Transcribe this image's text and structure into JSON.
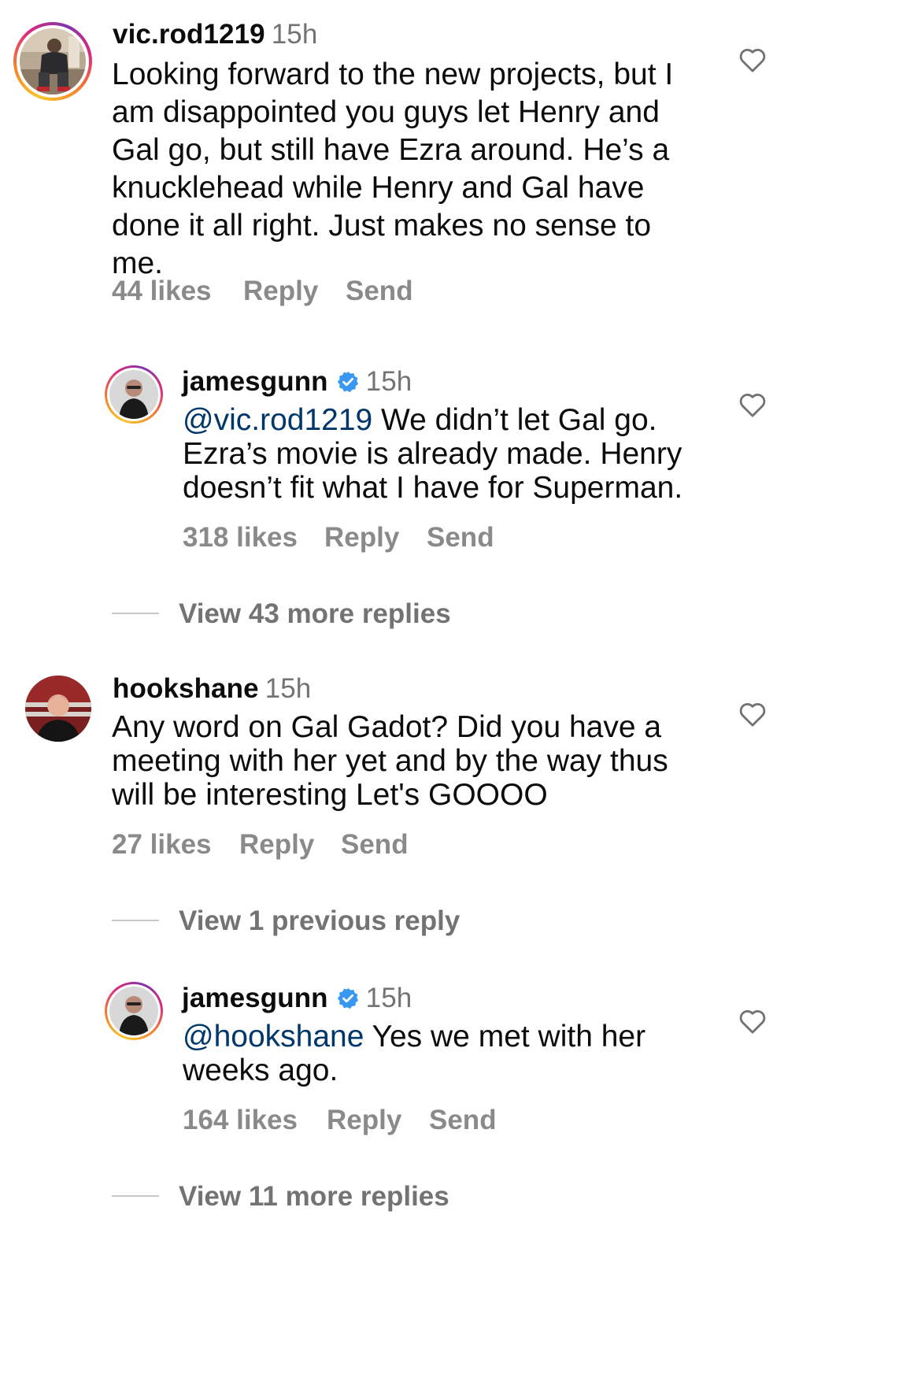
{
  "comments": [
    {
      "username": "vic.rod1219",
      "time": "15h",
      "lines": [
        "Looking forward to the new projects, but I",
        "am disappointed you guys let Henry and",
        "Gal go, but still have Ezra around. He’s a",
        "knucklehead while Henry and Gal have",
        "done it all right. Just makes no sense to",
        "me."
      ],
      "likes": "44 likes",
      "reply": "Reply",
      "send": "Send",
      "replies": [
        {
          "username": "jamesgunn",
          "verified": true,
          "time": "15h",
          "mention": "@vic.rod1219",
          "line1_rest": " We didn’t let Gal go.",
          "lines": [
            "Ezra’s movie is already made. Henry",
            "doesn’t fit what I have for Superman."
          ],
          "likes": "318 likes",
          "reply": "Reply",
          "send": "Send"
        }
      ],
      "view_more": "View 43 more replies"
    },
    {
      "username": "hookshane",
      "time": "15h",
      "lines": [
        "Any word on Gal Gadot? Did you have a",
        "meeting with her yet and by the way thus",
        "will be interesting Let's GOOOO"
      ],
      "likes": "27 likes",
      "reply": "Reply",
      "send": "Send",
      "view_previous": "View 1 previous reply",
      "replies": [
        {
          "username": "jamesgunn",
          "verified": true,
          "time": "15h",
          "mention": "@hookshane",
          "line1_rest": " Yes we met with her",
          "lines": [
            "weeks ago."
          ],
          "likes": "164 likes",
          "reply": "Reply",
          "send": "Send"
        }
      ],
      "view_more": "View 11 more replies"
    }
  ],
  "icons": {
    "like": "heart-outline-icon",
    "verified": "verified-badge-icon"
  },
  "colors": {
    "mention": "#00376b",
    "secondary_text": "#737373",
    "verified": "#3897f0",
    "story_ring_start": "#f9c52c",
    "story_ring_end": "#dd2a7b"
  }
}
